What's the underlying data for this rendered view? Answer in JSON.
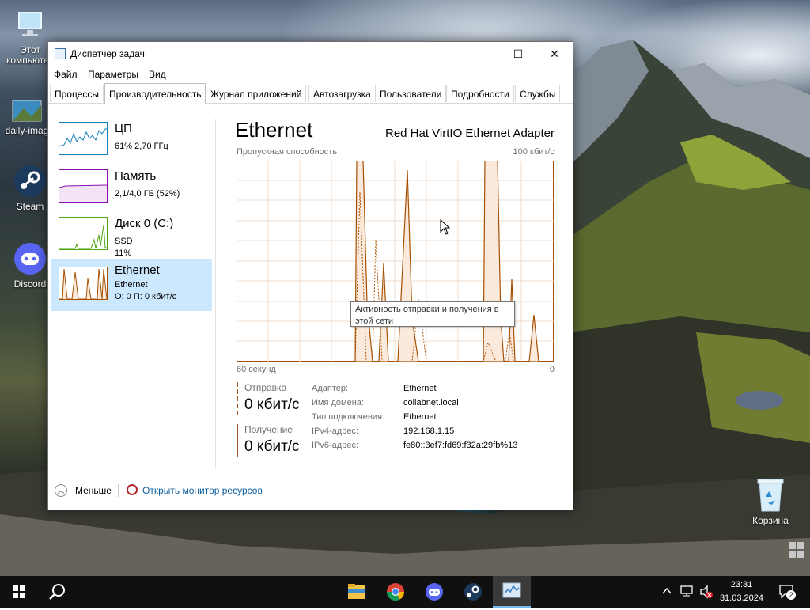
{
  "desktop": {
    "icons": [
      {
        "label": "Этот компьютер"
      },
      {
        "label": "daily-imag"
      },
      {
        "label": "Steam"
      },
      {
        "label": "Discord"
      },
      {
        "label": "Корзина"
      }
    ]
  },
  "window": {
    "title": "Диспетчер задач",
    "controls": {
      "minimize": "—",
      "maximize": "☐",
      "close": "✕"
    },
    "menu": [
      "Файл",
      "Параметры",
      "Вид"
    ],
    "tabs": [
      "Процессы",
      "Производительность",
      "Журнал приложений",
      "Автозагрузка",
      "Пользователи",
      "Подробности",
      "Службы"
    ],
    "active_tab": "Производительность"
  },
  "sidebar": {
    "items": [
      {
        "name": "ЦП",
        "line1": "61% 2,70 ГГц",
        "line2": "",
        "color": "#117dbb",
        "selected": false
      },
      {
        "name": "Память",
        "line1": "2,1/4,0 ГБ (52%)",
        "line2": "",
        "color": "#8b12ae",
        "selected": false
      },
      {
        "name": "Диск 0 (C:)",
        "line1": "SSD",
        "line2": "11%",
        "color": "#4da60c",
        "selected": false
      },
      {
        "name": "Ethernet",
        "line1": "Ethernet",
        "line2": "О: 0 П: 0 кбит/с",
        "color": "#a74f01",
        "selected": true
      }
    ]
  },
  "detail": {
    "title": "Ethernet",
    "adapter": "Red Hat VirtIO Ethernet Adapter",
    "throughput_label": "Пропускная способность",
    "max_label": "100 кбит/с",
    "time_left": "60 секунд",
    "time_right": "0",
    "tooltip": "Активность отправки и получения в этой сети",
    "send_label": "Отправка",
    "send_value": "0 кбит/с",
    "recv_label": "Получение",
    "recv_value": "0 кбит/с",
    "properties": [
      {
        "label": "Адаптер:",
        "value": "Ethernet"
      },
      {
        "label": "Имя домена:",
        "value": "collabnet.local"
      },
      {
        "label": "Тип подключения:",
        "value": "Ethernet"
      },
      {
        "label": "IPv4-адрес:",
        "value": "192.168.1.15"
      },
      {
        "label": "IPv6-адрес:",
        "value": "fe80::3ef7:fd69:f32a:29fb%13"
      }
    ],
    "accent": "#a74f01"
  },
  "footer": {
    "less_label": "Меньше",
    "resmon_label": "Открыть монитор ресурсов"
  },
  "taskbar": {
    "icons": [
      "windows-start-icon",
      "search-icon",
      "file-explorer-icon",
      "chrome-icon",
      "discord-icon",
      "steam-icon",
      "task-manager-icon"
    ],
    "time": "23:31",
    "date": "31.03.2024",
    "notification_count": "2"
  }
}
